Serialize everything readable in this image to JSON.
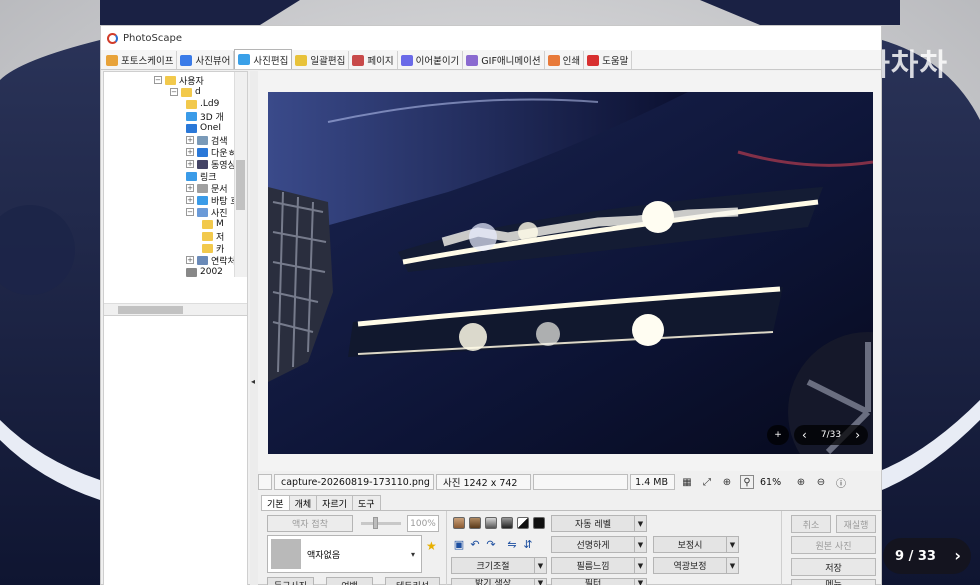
{
  "watermark": "KB차차차",
  "app": {
    "title": "PhotoScape"
  },
  "tabs": [
    {
      "label": "포토스케이프",
      "color": "#e8a33a"
    },
    {
      "label": "사진뷰어",
      "color": "#3a7be8"
    },
    {
      "label": "사진편집",
      "color": "#3aa0e8",
      "active": true
    },
    {
      "label": "일괄편집",
      "color": "#e8c23a"
    },
    {
      "label": "페이지",
      "color": "#c84a4a"
    },
    {
      "label": "이어붙이기",
      "color": "#6a6ae8"
    },
    {
      "label": "GIF애니메이션",
      "color": "#8a6ad0"
    },
    {
      "label": "인쇄",
      "color": "#e87a3a"
    },
    {
      "label": "도움말",
      "color": "#d83030"
    }
  ],
  "tree": {
    "items": [
      {
        "label": "사용자",
        "exp": "⊟",
        "color": "#f2c94c"
      },
      {
        "label": "d",
        "exp": "⊟",
        "color": "#f2c94c"
      },
      {
        "label": ".Ld9",
        "exp": "",
        "color": "#f2c94c"
      },
      {
        "label": "3D 개",
        "exp": "",
        "color": "#3a9be8"
      },
      {
        "label": "OneI",
        "exp": "",
        "color": "#2a78d8"
      },
      {
        "label": "검색",
        "exp": "⊞",
        "color": "#7a9ab8"
      },
      {
        "label": "다운ㅎ",
        "exp": "⊞",
        "color": "#2a78d8"
      },
      {
        "label": "동영싱",
        "exp": "⊞",
        "color": "#444466"
      },
      {
        "label": "링크",
        "exp": "",
        "color": "#3a9be8"
      },
      {
        "label": "문서",
        "exp": "⊞",
        "color": "#a0a0a0"
      },
      {
        "label": "바탕 호",
        "exp": "⊞",
        "color": "#3a9be8"
      },
      {
        "label": "사진",
        "exp": "⊟",
        "color": "#6a9ad8"
      },
      {
        "label": "M",
        "exp": "",
        "color": "#f2c94c"
      },
      {
        "label": "저",
        "exp": "",
        "color": "#f2c94c"
      },
      {
        "label": "카",
        "exp": "",
        "color": "#f2c94c"
      },
      {
        "label": "연락처",
        "exp": "⊞",
        "color": "#6a8ab8"
      },
      {
        "label": "2002",
        "exp": "",
        "color": "#888"
      }
    ]
  },
  "viewer": {
    "plus": "+",
    "prev": "‹",
    "next": "›",
    "page": "7/33"
  },
  "status": {
    "filename": "capture-20260819-173110.png",
    "dimensions": "사진 1242 x 742",
    "filesize": "1.4 MB",
    "zoom": "61%"
  },
  "panel_tabs": [
    "기본",
    "개체",
    "자르기",
    "도구"
  ],
  "tools": {
    "frame_attach": "액자 접착",
    "margin_value": "100%",
    "frame_none": "액자없음",
    "round_photo": "둥근사진",
    "margin": "여백",
    "frame_line": "테두리선",
    "auto_level": "자동 레벨",
    "sharpen": "선명하게",
    "backlight": "보정시",
    "resize": "크기조절",
    "film_effect": "필름느낌",
    "backlight_fix": "역광보정",
    "brightness_color": "밝기,색상",
    "filter": "필터"
  },
  "right_buttons": {
    "undo": "취소",
    "redo": "재실행",
    "original": "원본 사진",
    "save": "저장",
    "menu": "메뉴"
  },
  "counter": {
    "text": "9 / 33",
    "next": "›"
  }
}
